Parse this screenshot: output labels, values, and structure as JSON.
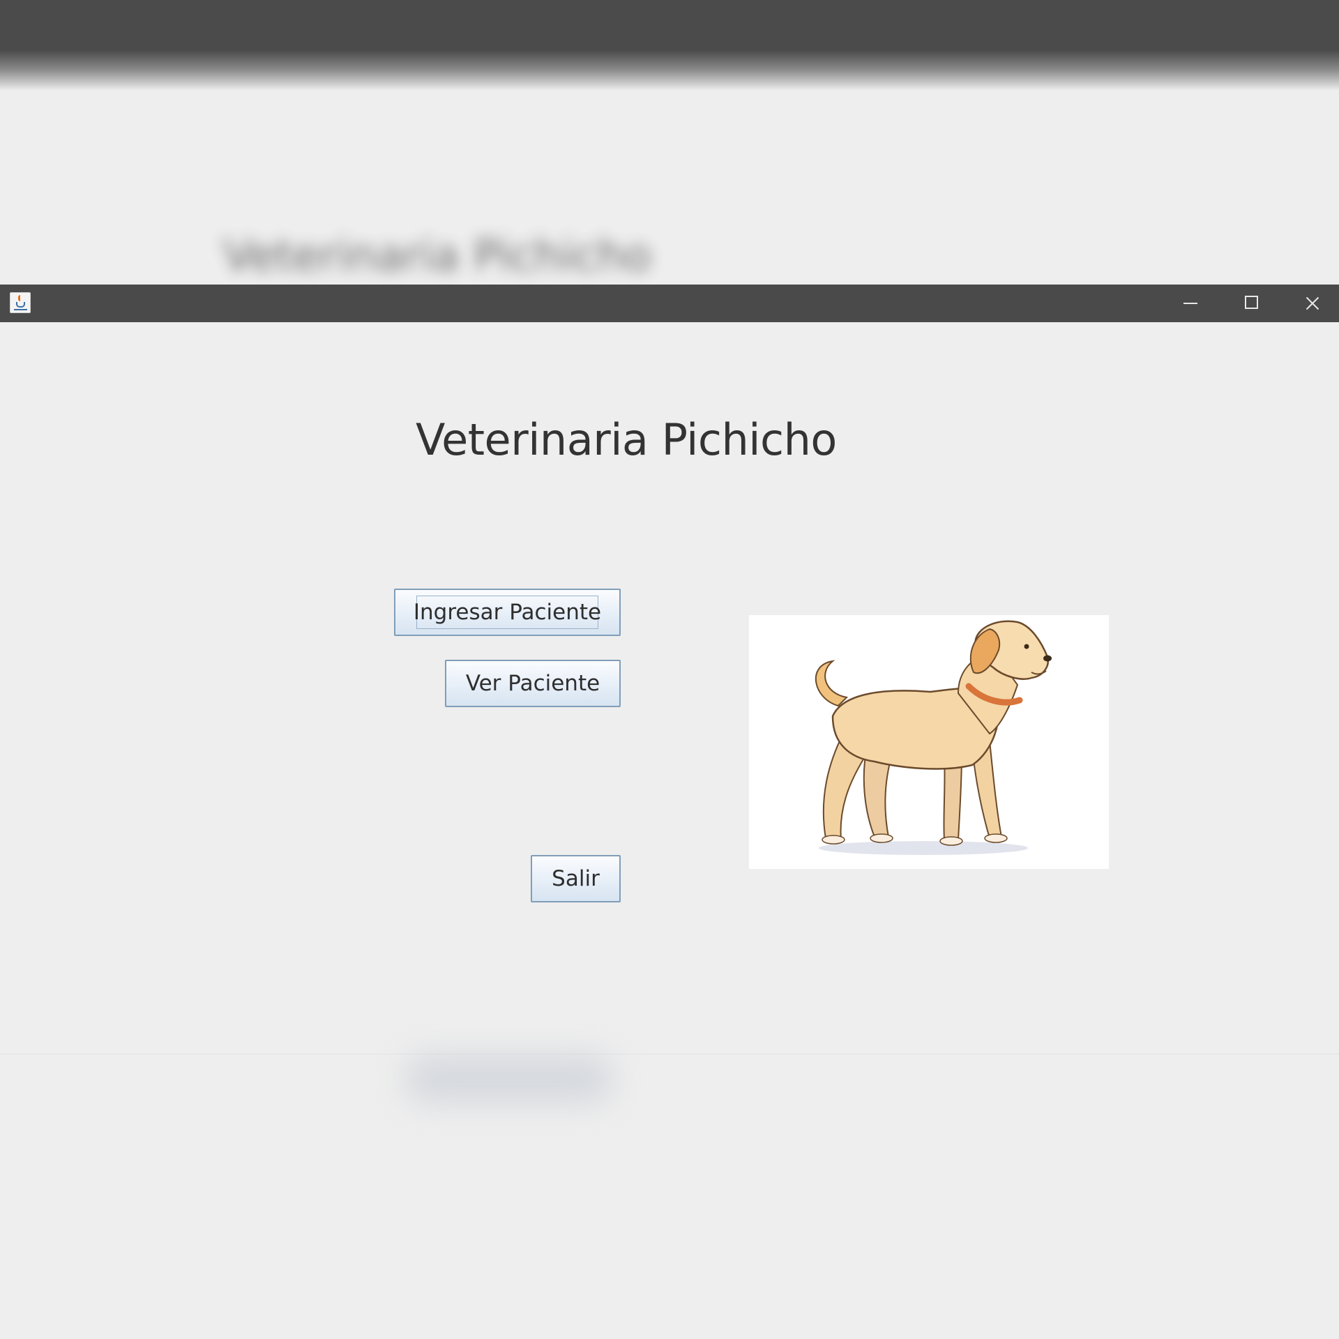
{
  "background_window": {
    "title_text": "Veterinaria Pichicho"
  },
  "window": {
    "icon": "java-cup-icon",
    "controls": {
      "minimize_icon": "minimize-icon",
      "maximize_icon": "maximize-icon",
      "close_icon": "close-icon"
    }
  },
  "main": {
    "title": "Veterinaria Pichicho",
    "buttons": {
      "ingresar_label": "Ingresar Paciente",
      "ver_label": "Ver Paciente",
      "salir_label": "Salir"
    },
    "image": {
      "subject": "dog-illustration",
      "background": "#ffffff"
    }
  },
  "colors": {
    "titlebar": "#4a4a4a",
    "window_bg": "#eeeeee",
    "button_border": "#7f9db9",
    "text": "#333333"
  }
}
